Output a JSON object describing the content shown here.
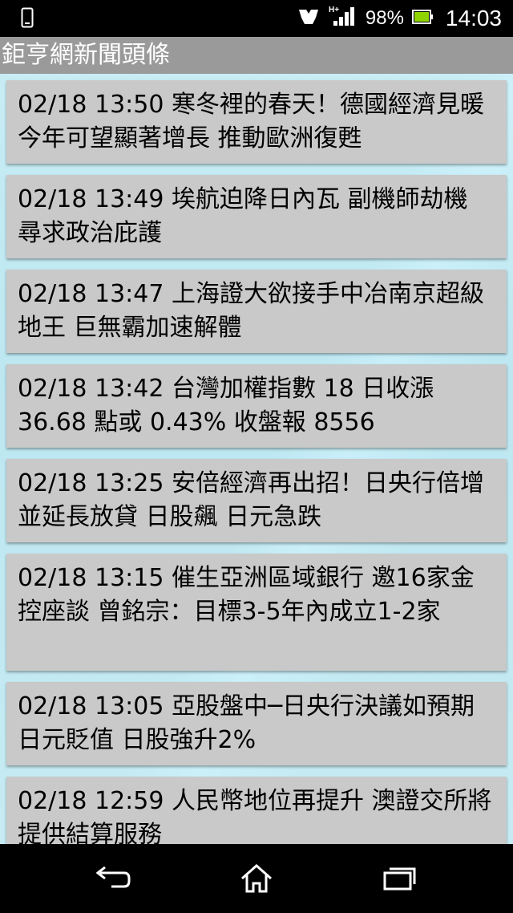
{
  "status_bar": {
    "network_label": "H+",
    "battery_percent": "98%",
    "time": "14:03",
    "icons": [
      "phone-icon",
      "signal-icon",
      "battery-icon"
    ]
  },
  "app": {
    "title": "鉅亨網新聞頭條"
  },
  "news": [
    {
      "text": "02/18 13:50 寒冬裡的春天！德國經濟見暖 今年可望顯著增長 推動歐洲復甦"
    },
    {
      "text": "02/18 13:49 埃航迫降日內瓦 副機師劫機 尋求政治庇護"
    },
    {
      "text": "02/18 13:47 上海證大欲接手中冶南京超級地王 巨無霸加速解體"
    },
    {
      "text": "02/18 13:42 台灣加權指數 18 日收漲 36.68 點或 0.43% 收盤報 8556"
    },
    {
      "text": "02/18 13:25 安倍經濟再出招！日央行倍增並延長放貸 日股飆 日元急跌"
    },
    {
      "text": "02/18 13:15 催生亞洲區域銀行 邀16家金控座談 曾銘宗：目標3-5年內成立1-2家"
    },
    {
      "text": "02/18 13:05 亞股盤中─日央行決議如預期 日元貶值 日股強升2%"
    },
    {
      "text": "02/18 12:59 人民幣地位再提升 澳證交所將提供結算服務"
    }
  ],
  "nav_bar": {
    "icons": [
      "back-icon",
      "home-icon",
      "recent-apps-icon"
    ]
  }
}
